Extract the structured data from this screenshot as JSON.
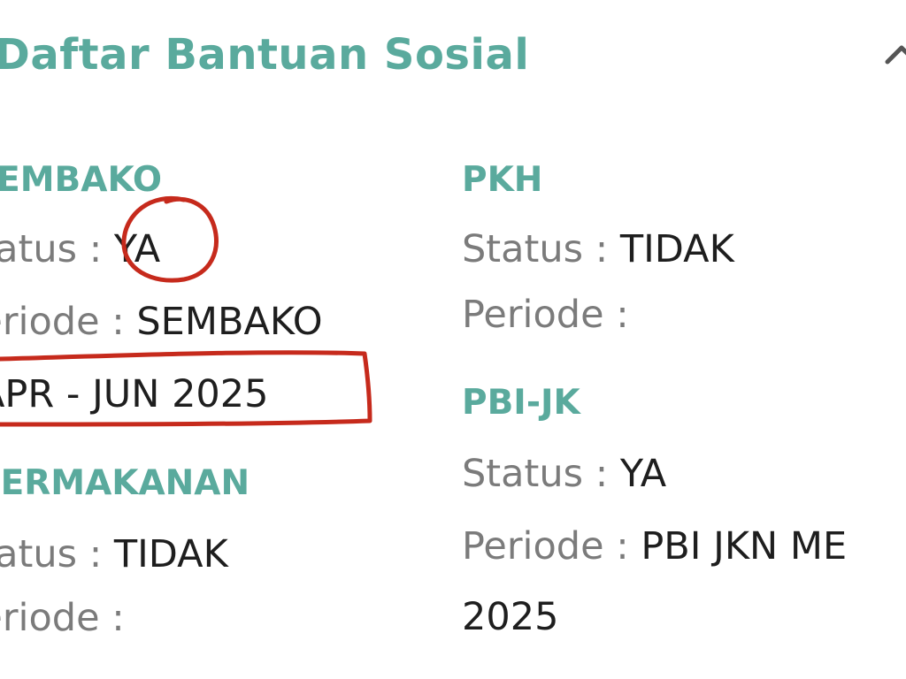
{
  "card": {
    "title": "Daftar Bantuan Sosial",
    "collapse_icon": "chevron-up-icon",
    "status_label": "Status :",
    "periode_label": "Periode :"
  },
  "programs": {
    "sembako": {
      "name": "SEMBAKO",
      "status": "YA",
      "periode_line1": "SEMBAKO",
      "periode_line2": "APR - JUN 2025"
    },
    "permakanan": {
      "name": "PERMAKANAN",
      "status": "TIDAK",
      "periode": ""
    },
    "pkh": {
      "name": "PKH",
      "status": "TIDAK",
      "periode": ""
    },
    "pbi_jk": {
      "name": "PBI-JK",
      "status": "YA",
      "periode_line1": "PBI JKN ME",
      "periode_line2": "2025"
    }
  },
  "annotations": {
    "color": "#c62a1c"
  }
}
